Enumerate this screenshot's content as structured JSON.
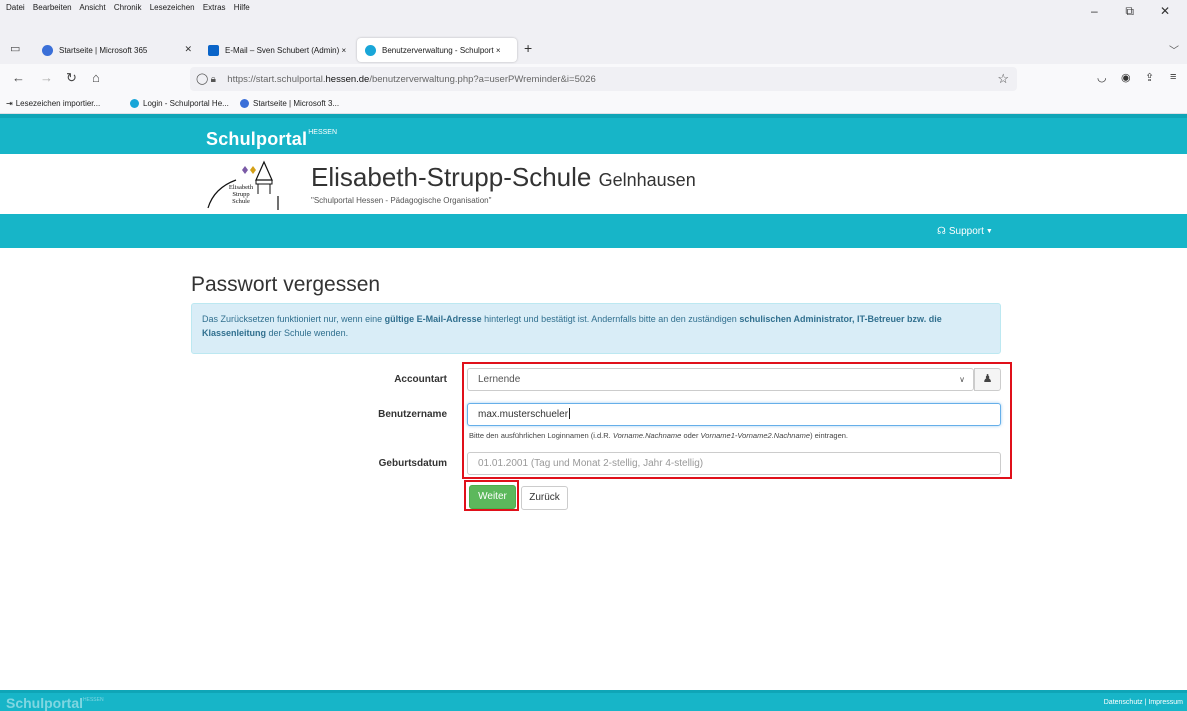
{
  "browser": {
    "menu": [
      "Datei",
      "Bearbeiten",
      "Ansicht",
      "Chronik",
      "Lesezeichen",
      "Extras",
      "Hilfe"
    ],
    "window_controls": {
      "minimize": "–",
      "restore": "⧉",
      "close": "✕"
    },
    "tabs": [
      {
        "title": "Startseite | Microsoft 365",
        "icon_color": "#3a6fd8",
        "active": false
      },
      {
        "title": "E-Mail – Sven Schubert (Admin) ×",
        "icon_color": "#0a64c8",
        "active": false
      },
      {
        "title": "Benutzerverwaltung - Schulport ×",
        "icon_color": "#19a6d8",
        "active": true
      }
    ],
    "new_tab": "+",
    "url": {
      "prefix": "https://start.schulportal.",
      "host": "hessen.de",
      "path": "/benutzerverwaltung.php?a=userPWreminder&i=5026"
    },
    "bookmarks": [
      {
        "label": "Lesezeichen importier...",
        "icon": "import-icon"
      },
      {
        "label": "Login - Schulportal He...",
        "icon": "globe-icon"
      },
      {
        "label": "Startseite | Microsoft 3...",
        "icon": "microsoft-icon"
      }
    ],
    "accent": "#17b5c8"
  },
  "page": {
    "brand": {
      "name": "Schulportal",
      "sup": "HESSEN"
    },
    "school": {
      "name": "Elisabeth-Strupp-Schule",
      "city": "Gelnhausen",
      "subtitle": "\"Schulportal Hessen - Pädagogische Organisation\"",
      "logo_text": [
        "Elisabeth",
        "Strupp",
        "Schule"
      ]
    },
    "nav": {
      "support_label": "Support"
    },
    "title": "Passwort vergessen",
    "info": {
      "part1": "Das Zurücksetzen funktioniert nur, wenn eine ",
      "bold1": "gültige E-Mail-Adresse",
      "part2": " hinterlegt und bestätigt ist. Andernfalls bitte an den zuständigen ",
      "bold2": "schulischen Administrator, IT-Betreuer bzw. die Klassenleitung",
      "part3": " der Schule wenden."
    },
    "form": {
      "account_label": "Accountart",
      "account_value": "Lernende",
      "username_label": "Benutzername",
      "username_value": "max.musterschueler",
      "hint": {
        "part1": "Bitte den ausführlichen Loginnamen (i.d.R. ",
        "ital1": "Vorname.Nachname",
        "part2": " oder ",
        "ital2": "Vorname1-Vorname2.Nachname",
        "part3": ") eintragen."
      },
      "birthdate_label": "Geburtsdatum",
      "birthdate_placeholder": "01.01.2001 (Tag und Monat 2-stellig, Jahr 4-stellig)",
      "next_button": "Weiter",
      "back_button": "Zurück"
    },
    "footer": {
      "brand": "Schulportal",
      "sup": "HESSEN",
      "links": "Datenschutz | Impressum"
    },
    "colors": {
      "primary": "#17b5c8",
      "success": "#5cb85c",
      "highlight": "#e0101a",
      "info_bg": "#d9edf7"
    }
  }
}
